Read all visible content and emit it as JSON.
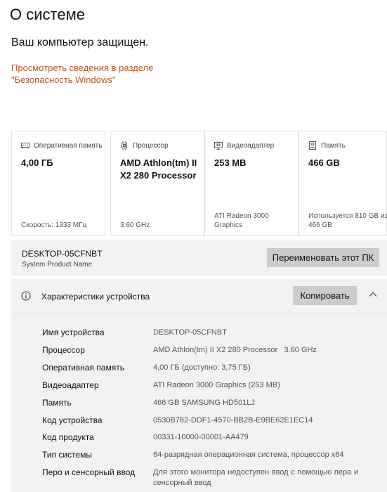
{
  "page_title": "О системе",
  "protection_status": "Ваш компьютер защищен.",
  "security_link_line1": "Просмотреть сведения в разделе",
  "security_link_line2": "\"Безопасность Windows\"",
  "cards": [
    {
      "icon": "ram-icon",
      "title": "Оперативная память",
      "value": "4,00 ГБ",
      "footer": "Скорость: 1333 МГц"
    },
    {
      "icon": "processor-icon",
      "title": "Процессор",
      "value": "AMD Athlon(tm) II X2 280 Processor",
      "footer": "3.60 GHz"
    },
    {
      "icon": "video-adapter-icon",
      "title": "Видеоадаптер",
      "value": "253 MB",
      "footer": "ATI Radeon 3000 Graphics"
    },
    {
      "icon": "storage-icon",
      "title": "Память",
      "value": "466 GB",
      "footer": "Используется 810 GB из 466 GB"
    }
  ],
  "device_name_panel": {
    "pc_name": "DESKTOP-05CFNBT",
    "product_name": "System Product Name",
    "rename_button": "Переименовать этот ПК"
  },
  "specs": {
    "title": "Характеристики устройства",
    "copy_button": "Копировать",
    "rows": [
      {
        "label": "Имя устройства",
        "value": "DESKTOP-05CFNBT"
      },
      {
        "label": "Процессор",
        "value": "AMD Athlon(tm) II X2 280 Processor   3.60 GHz"
      },
      {
        "label": "Оперативная память",
        "value": "4,00 ГБ (доступно: 3,75 ГБ)"
      },
      {
        "label": "Видеоадаптер",
        "value": "ATI Radeon 3000 Graphics (253 MB)"
      },
      {
        "label": "Память",
        "value": "466 GB SAMSUNG HD501LJ"
      },
      {
        "label": "Код устройства",
        "value": "0530B782-DDF1-4570-BB2B-E9BE62E1EC14"
      },
      {
        "label": "Код продукта",
        "value": "00331-10000-00001-AA479"
      },
      {
        "label": "Тип системы",
        "value": "64-разрядная операционная система, процессор x64"
      },
      {
        "label": "Перо и сенсорный ввод",
        "value": "Для этого монитора недоступен ввод с помощью пера и сенсорный ввод"
      }
    ]
  },
  "colors": {
    "link": "#c4511f",
    "panel": "#f2f2f2",
    "button": "#cccccc"
  }
}
